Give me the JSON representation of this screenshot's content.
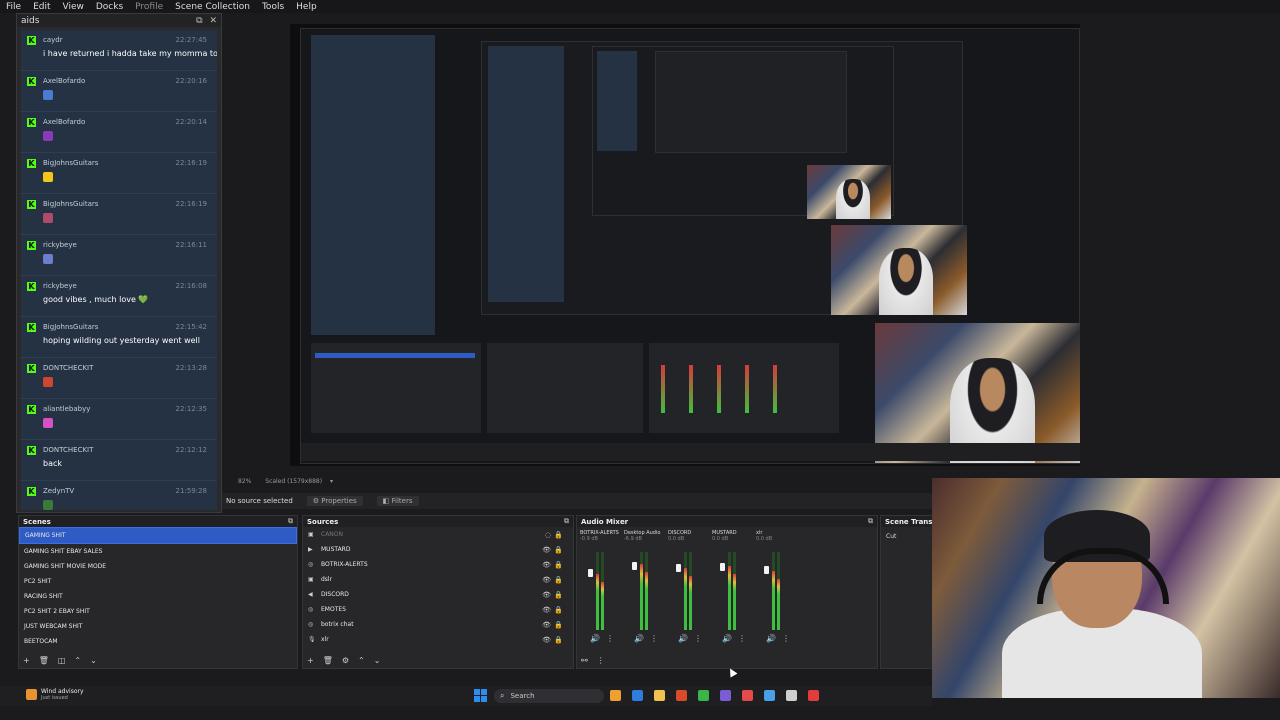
{
  "menu": {
    "items": [
      {
        "label": "File",
        "dim": false
      },
      {
        "label": "Edit",
        "dim": false
      },
      {
        "label": "View",
        "dim": false
      },
      {
        "label": "Docks",
        "dim": false
      },
      {
        "label": "Profile",
        "dim": true
      },
      {
        "label": "Scene Collection",
        "dim": false
      },
      {
        "label": "Tools",
        "dim": false
      },
      {
        "label": "Help",
        "dim": false
      }
    ]
  },
  "chat_dock": {
    "title": "aids",
    "messages": [
      {
        "user": "caydr",
        "time": "22:27:45",
        "text": "i have returned i hadda take my momma to work",
        "emote_color": ""
      },
      {
        "user": "AxelBofardo",
        "time": "22:20:16",
        "text": "",
        "emote_color": "#4a7bd0"
      },
      {
        "user": "AxelBofardo",
        "time": "22:20:14",
        "text": "",
        "emote_color": "#8a3ab9"
      },
      {
        "user": "BigJohnsGuitars",
        "time": "22:16:19",
        "text": "",
        "emote_color": "#f3c61b"
      },
      {
        "user": "BigJohnsGuitars",
        "time": "22:16:19",
        "text": "",
        "emote_color": "#b04a6a"
      },
      {
        "user": "rickybeye",
        "time": "22:16:11",
        "text": "",
        "emote_color": "#6a7fd0"
      },
      {
        "user": "rickybeye",
        "time": "22:16:08",
        "text": "good vibes , much love 💚",
        "emote_color": ""
      },
      {
        "user": "BigJohnsGuitars",
        "time": "22:15:42",
        "text": "hoping wilding out yesterday went well",
        "emote_color": ""
      },
      {
        "user": "DONTCHECKIT",
        "time": "22:13:28",
        "text": "",
        "emote_color": "#d0452f"
      },
      {
        "user": "aliantlebabyy",
        "time": "22:12:35",
        "text": "",
        "emote_color": "#d64fc8"
      },
      {
        "user": "DONTCHECKIT",
        "time": "22:12:12",
        "text": "back",
        "emote_color": ""
      },
      {
        "user": "ZedynTV",
        "time": "21:59:28",
        "text": "",
        "emote_color": "#3a7a3a"
      }
    ]
  },
  "preview": {
    "zoom": "82%",
    "scale": "Scaled (1579x888)"
  },
  "props_bar": {
    "status": "No source selected",
    "properties": "Properties",
    "filters": "Filters"
  },
  "scenes": {
    "title": "Scenes",
    "items": [
      {
        "label": "GAMING SHIT",
        "selected": true
      },
      {
        "label": "GAMING SHIT EBAY SALES",
        "selected": false
      },
      {
        "label": "GAMING SHIT MOVIE MODE",
        "selected": false
      },
      {
        "label": "PC2 SHIT",
        "selected": false
      },
      {
        "label": "RACING SHIT",
        "selected": false
      },
      {
        "label": "PC2 SHIT 2 EBAY SHIT",
        "selected": false
      },
      {
        "label": "JUST WEBCAM SHIT",
        "selected": false
      },
      {
        "label": "BEETOCAM",
        "selected": false
      }
    ]
  },
  "sources": {
    "title": "Sources",
    "items": [
      {
        "label": "CANON",
        "icon": "camera-icon",
        "dim": true
      },
      {
        "label": "MUSTARD",
        "icon": "play-icon",
        "dim": false
      },
      {
        "label": "BOTRIX-ALERTS",
        "icon": "globe-icon",
        "dim": false
      },
      {
        "label": "dslr",
        "icon": "camera-icon",
        "dim": false
      },
      {
        "label": "DISCORD",
        "icon": "speaker-icon",
        "dim": false
      },
      {
        "label": "EMOTES",
        "icon": "globe-icon",
        "dim": false
      },
      {
        "label": "botrix chat",
        "icon": "globe-icon",
        "dim": false
      },
      {
        "label": "xlr",
        "icon": "mic-icon",
        "dim": false
      }
    ]
  },
  "mixer": {
    "title": "Audio Mixer",
    "channels": [
      {
        "name": "BOTRIX-ALERTS",
        "db": "-0.9 dB",
        "level": 0.72
      },
      {
        "name": "Desktop Audio",
        "db": "-6.9 dB",
        "level": 0.84
      },
      {
        "name": "DISCORD",
        "db": "0.0 dB",
        "level": 0.8
      },
      {
        "name": "MUSTARD",
        "db": "0.0 dB",
        "level": 0.82
      },
      {
        "name": "xlr",
        "db": "0.0 dB",
        "level": 0.76
      }
    ]
  },
  "transitions": {
    "title": "Scene Transitions",
    "value": "Cut"
  },
  "taskbar": {
    "weather_title": "Wind advisory",
    "weather_sub": "Just issued",
    "search": "Search",
    "colors": [
      "#f0a030",
      "#2e7ddc",
      "#f2c14e",
      "#d84a2a",
      "#3ab54a",
      "#7b5cd6",
      "#e34a4a",
      "#4aa0e6",
      "#cfcfcf",
      "#e23d3d"
    ]
  }
}
